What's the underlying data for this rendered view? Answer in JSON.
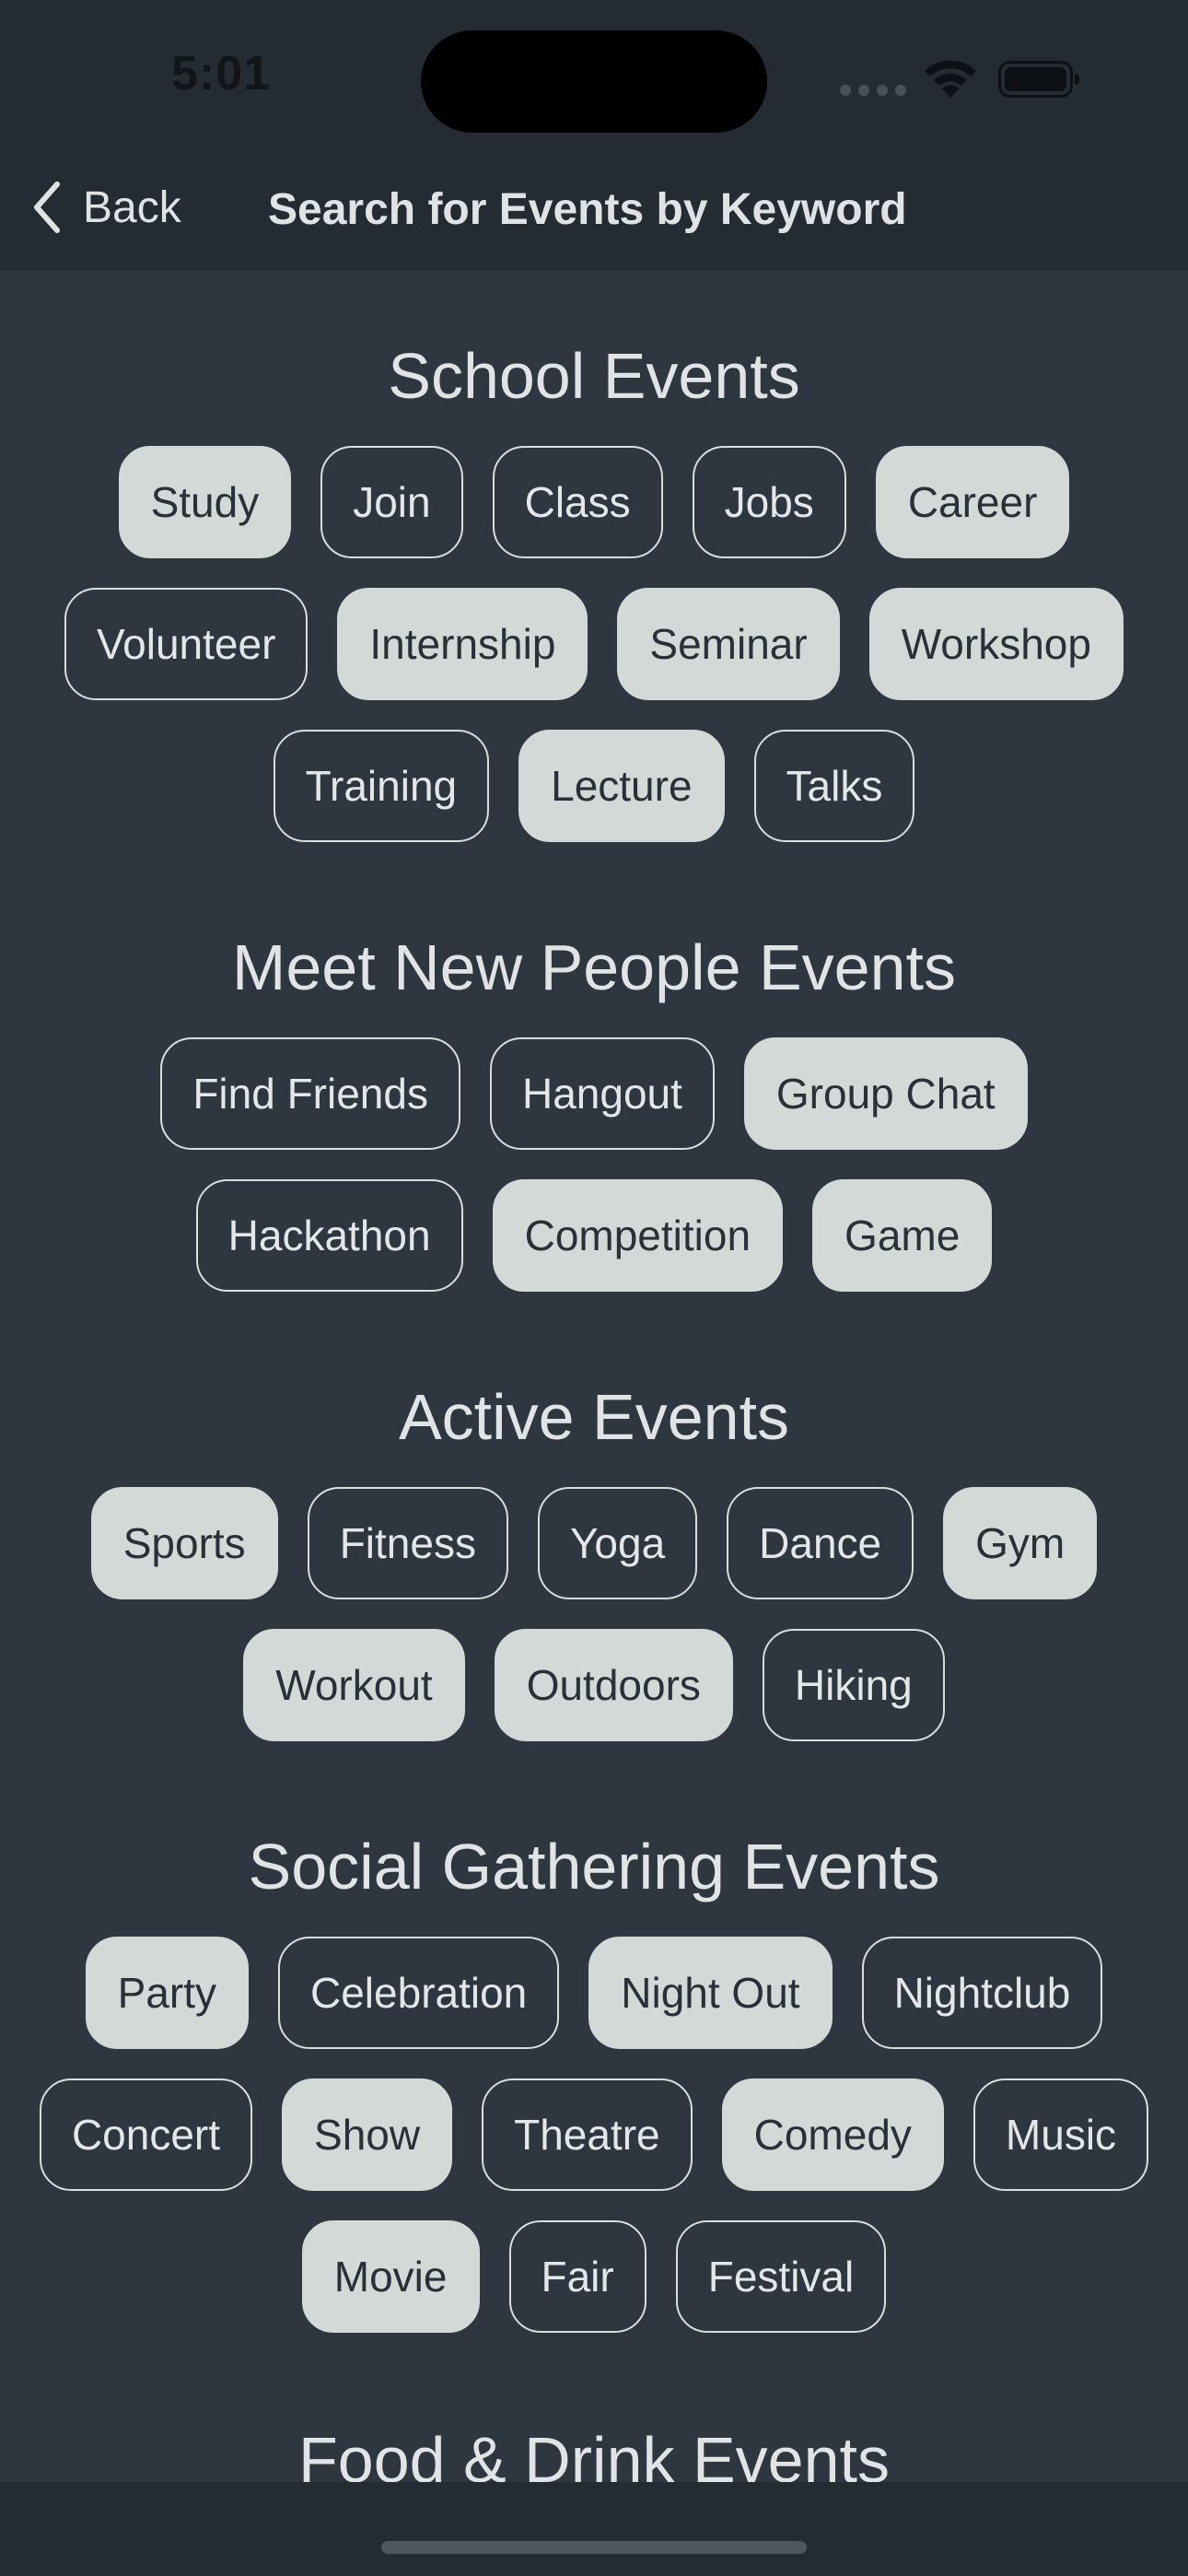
{
  "status_bar": {
    "time": "5:01"
  },
  "nav": {
    "back_label": "Back",
    "title": "Search for Events by Keyword"
  },
  "colors": {
    "background": "#2e3640",
    "bar_background": "#252b33",
    "chip_selected_bg": "#d3d9d7",
    "chip_text_light": "#e3e7ea",
    "chip_text_dark": "#2a3038"
  },
  "sections": [
    {
      "title": "School Events",
      "rows": [
        [
          {
            "label": "Study",
            "selected": true
          },
          {
            "label": "Join",
            "selected": false
          },
          {
            "label": "Class",
            "selected": false
          },
          {
            "label": "Jobs",
            "selected": false
          },
          {
            "label": "Career",
            "selected": true
          }
        ],
        [
          {
            "label": "Volunteer",
            "selected": false
          },
          {
            "label": "Internship",
            "selected": true
          },
          {
            "label": "Seminar",
            "selected": true
          },
          {
            "label": "Workshop",
            "selected": true
          }
        ],
        [
          {
            "label": "Training",
            "selected": false
          },
          {
            "label": "Lecture",
            "selected": true
          },
          {
            "label": "Talks",
            "selected": false
          }
        ]
      ]
    },
    {
      "title": "Meet New People Events",
      "rows": [
        [
          {
            "label": "Find Friends",
            "selected": false
          },
          {
            "label": "Hangout",
            "selected": false
          },
          {
            "label": "Group Chat",
            "selected": true
          }
        ],
        [
          {
            "label": "Hackathon",
            "selected": false
          },
          {
            "label": "Competition",
            "selected": true
          },
          {
            "label": "Game",
            "selected": true
          }
        ]
      ]
    },
    {
      "title": "Active Events",
      "rows": [
        [
          {
            "label": "Sports",
            "selected": true
          },
          {
            "label": "Fitness",
            "selected": false
          },
          {
            "label": "Yoga",
            "selected": false
          },
          {
            "label": "Dance",
            "selected": false
          },
          {
            "label": "Gym",
            "selected": true
          }
        ],
        [
          {
            "label": "Workout",
            "selected": true
          },
          {
            "label": "Outdoors",
            "selected": true
          },
          {
            "label": "Hiking",
            "selected": false
          }
        ]
      ]
    },
    {
      "title": "Social Gathering Events",
      "rows": [
        [
          {
            "label": "Party",
            "selected": true
          },
          {
            "label": "Celebration",
            "selected": false
          },
          {
            "label": "Night Out",
            "selected": true
          },
          {
            "label": "Nightclub",
            "selected": false
          }
        ],
        [
          {
            "label": "Concert",
            "selected": false
          },
          {
            "label": "Show",
            "selected": true
          },
          {
            "label": "Theatre",
            "selected": false
          },
          {
            "label": "Comedy",
            "selected": true
          },
          {
            "label": "Music",
            "selected": false
          }
        ],
        [
          {
            "label": "Movie",
            "selected": true
          },
          {
            "label": "Fair",
            "selected": false
          },
          {
            "label": "Festival",
            "selected": false
          }
        ]
      ]
    },
    {
      "title": "Food & Drink Events",
      "rows": []
    }
  ]
}
